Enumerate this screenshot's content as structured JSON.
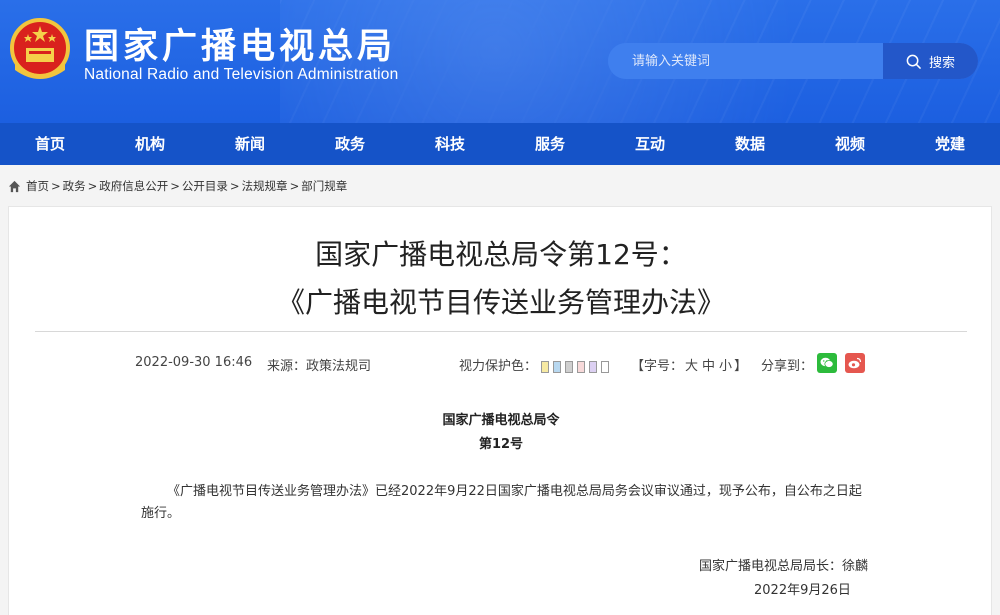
{
  "header": {
    "title_cn": "国家广播电视总局",
    "title_en": "National Radio and Television Administration",
    "emblem_icon": "national-emblem-icon"
  },
  "search": {
    "placeholder": "请输入关键词",
    "button_label": "搜索"
  },
  "nav": {
    "items": [
      "首页",
      "机构",
      "新闻",
      "政务",
      "科技",
      "服务",
      "互动",
      "数据",
      "视频",
      "党建"
    ]
  },
  "breadcrumb": {
    "items": [
      "首页",
      "政务",
      "政府信息公开",
      "公开目录",
      "法规规章",
      "部门规章"
    ],
    "separator": ">"
  },
  "article": {
    "title_line1": "国家广播电视总局令第12号：",
    "title_line2": "《广播电视节目传送业务管理办法》",
    "date": "2022-09-30 16:46",
    "source": "来源：政策法规司",
    "eye_care_label": "视力保护色：",
    "eye_care_colors": [
      "#f7eaa3",
      "#b8d8f0",
      "#cfcfcf",
      "#f7d9d9",
      "#dcd0f2",
      "#ffffff"
    ],
    "font_size_label_open": "【字号：",
    "font_sizes": [
      "大",
      "中",
      "小"
    ],
    "font_size_label_close": "】",
    "share_label": "分享到：",
    "decree_org": "国家广播电视总局令",
    "decree_num": "第12号",
    "body": "《广播电视节目传送业务管理办法》已经2022年9月22日国家广播电视总局局务会议审议通过，现予公布，自公布之日起施行。",
    "signature": "国家广播电视总局局长：徐麟",
    "sign_date": "2022年9月26日"
  },
  "colors": {
    "header_blue": "#1f63e4",
    "nav_blue": "#1553c8",
    "wechat_green": "#2dbb3c",
    "weibo_red": "#e5574f"
  }
}
